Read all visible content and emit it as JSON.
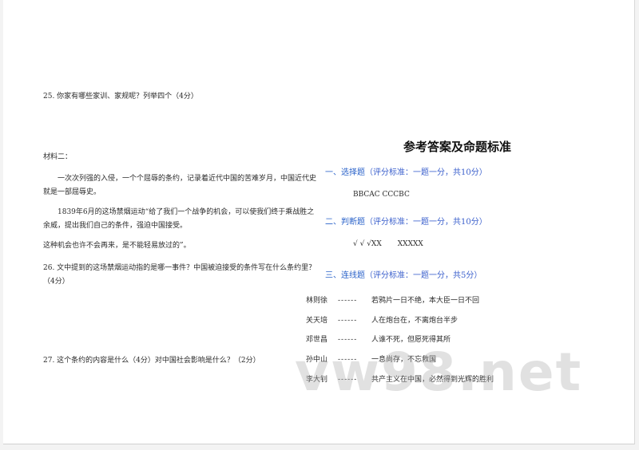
{
  "left": {
    "q25": "25. 你家有哪些家训、家规呢？列举四个（4分）",
    "material_label": "材料二：",
    "para1": "一次次列强的入侵，一个个屈辱的条约，记录着近代中国的苦难岁月，中国近代史就是一部屈辱史。",
    "para2": "1839年6月的这场禁烟运动“给了我们一个战争的机会，可以使我们终于乘战胜之余威，提出我们自己的条件，强迫中国接受。",
    "para3": "这种机会也许不会再来，是不能轻易放过的”。",
    "q26": "26. 文中提到的这场禁烟运动指的是哪一事件？中国被迫接受的条件写在什么条约里？（4分）",
    "q27": "27. 这个条约的内容是什么（4分）对中国社会影响是什么？（2分）"
  },
  "right": {
    "title": "参考答案及命题标准",
    "sections": [
      {
        "head": "一、选择题",
        "std": "（评分标准：一题一分，共10分）",
        "answer": "BBCAC    CCCBC"
      },
      {
        "head": "二、判断题",
        "std": "（评分标准：一题一分，共10分）",
        "answer": "√ √ √XX       XXXXX"
      },
      {
        "head": "三、连线题",
        "std": "（评分标准：一题一分，共5分）"
      }
    ],
    "matches": [
      {
        "name": "林则徐",
        "dash": "------",
        "text": "若鸦片一日不绝，本大臣一日不回"
      },
      {
        "name": "关天培",
        "dash": "------",
        "text": "人在炮台在，不离炮台半步"
      },
      {
        "name": "邓世昌",
        "dash": "------",
        "text": "人谁不死，但愿死得其所"
      },
      {
        "name": "孙中山",
        "dash": "------",
        "text": "一息尚存，不忘救国"
      },
      {
        "name": "李大钊",
        "dash": "------",
        "text": "共产主义在中国，必然得到光辉的胜利"
      }
    ]
  },
  "watermark": "vw98.net"
}
